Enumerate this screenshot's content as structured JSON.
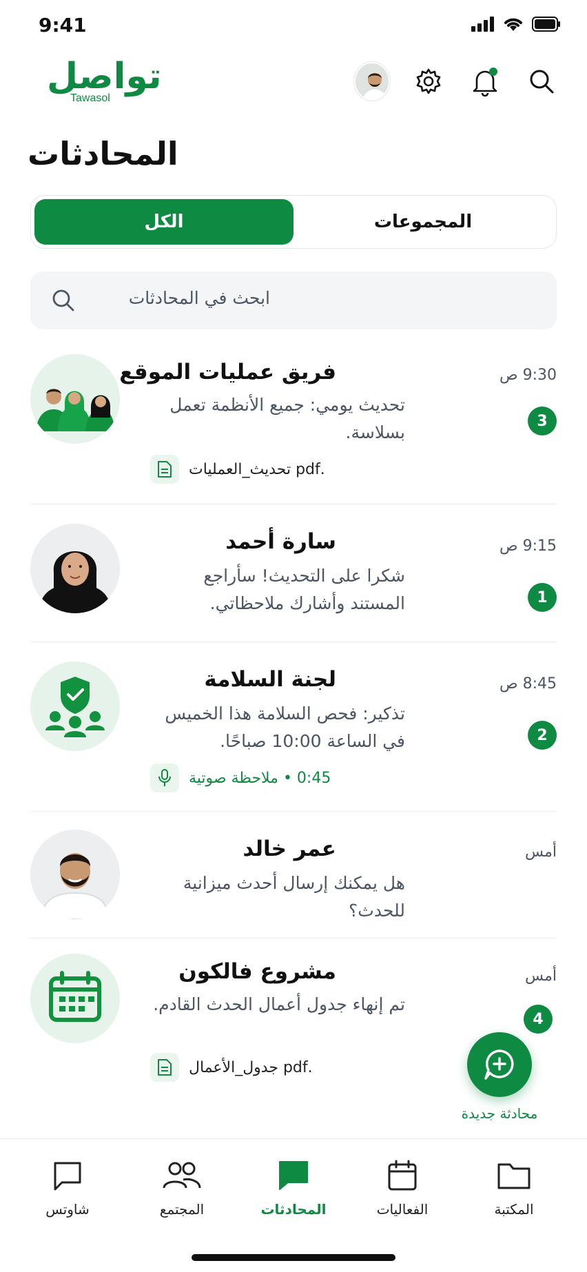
{
  "status_bar": {
    "time": "9:41"
  },
  "app": {
    "logo_ar": "تواصل",
    "logo_en": "Tawasol"
  },
  "header": {
    "icons": [
      "avatar",
      "gear-icon",
      "bell-icon",
      "search-icon"
    ],
    "notification_dot_color": "#0f8a43"
  },
  "page": {
    "title": "المحادثات"
  },
  "tabs": {
    "all": "الكل",
    "groups": "المجموعات",
    "active": "all"
  },
  "search": {
    "placeholder": "ابحث في المحادثات"
  },
  "chats": [
    {
      "title": "فريق عمليات الموقع",
      "time": "9:30 ص",
      "message": "تحديث يومي: جميع الأنظمة تعمل بسلاسة.",
      "badge": "3",
      "attachment": ".pdf تحديث_العمليات",
      "attachment_type": "file",
      "avatar": "group-people"
    },
    {
      "title": "سارة أحمد",
      "time": "9:15 ص",
      "message": "شكرا على التحديث! سأراجع المستند وأشارك ملاحظاتي.",
      "badge": "1",
      "avatar": "woman-hijab"
    },
    {
      "title": "لجنة السلامة",
      "time": "8:45 ص",
      "message": "تذكير: فحص السلامة هذا الخميس في الساعة 10:00 صباحًا.",
      "badge": "2",
      "attachment": "0:45 • ملاحظة صوتية",
      "attachment_type": "voice",
      "avatar": "shield-group-icon"
    },
    {
      "title": "عمر خالد",
      "time": "أمس",
      "message": "هل يمكنك إرسال أحدث ميزانية للحدث؟",
      "avatar": "man"
    },
    {
      "title": "مشروع فالكون",
      "time": "أمس",
      "message": "تم إنهاء جدول أعمال الحدث القادم.",
      "badge": "4",
      "attachment": ".pdf جدول_الأعمال",
      "attachment_type": "file",
      "avatar": "calendar-icon"
    }
  ],
  "fab": {
    "label": "محادثة جديدة"
  },
  "bottom_nav": [
    {
      "label": "شاوتس",
      "icon": "chat-bubble-outline-icon"
    },
    {
      "label": "المجتمع",
      "icon": "people-icon"
    },
    {
      "label": "المحادثات",
      "icon": "chat-bubble-filled-icon",
      "active": true
    },
    {
      "label": "الفعاليات",
      "icon": "calendar-icon"
    },
    {
      "label": "المكتبة",
      "icon": "folder-icon"
    }
  ],
  "colors": {
    "brand": "#0f8a43",
    "text": "#111111",
    "muted": "#4b5563"
  }
}
